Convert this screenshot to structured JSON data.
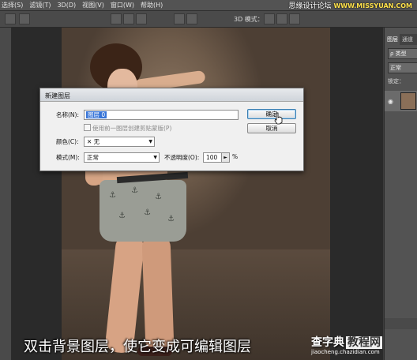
{
  "menu": {
    "items": [
      "选择(S)",
      "滤镜(T)",
      "3D(D)",
      "视图(V)",
      "窗口(W)",
      "帮助(H)"
    ]
  },
  "watermark_top": {
    "text": "思缘设计论坛",
    "url": "WWW.MISSYUAN.COM"
  },
  "options_bar": {
    "mode_label": "3D 模式："
  },
  "layers_panel": {
    "tabs": [
      "图层",
      "通道"
    ],
    "filter_label": "ρ 类型",
    "blend_mode": "正常",
    "lock_label": "锁定："
  },
  "dialog": {
    "title": "新建图层",
    "name_label": "名称(N):",
    "name_value": "图层 0",
    "clip_checkbox_label": "使用前一图层创建剪贴蒙版(P)",
    "color_label": "颜色(C):",
    "color_value": "✕ 无",
    "mode_label": "模式(M):",
    "mode_value": "正常",
    "opacity_label": "不透明度(O):",
    "opacity_value": "100",
    "opacity_unit": "%",
    "ok_label": "确定",
    "cancel_label": "取消"
  },
  "subtitle": "双击背景图层，使它变成可编辑图层",
  "watermark_bottom": {
    "brand": "查字典",
    "highlight": "教程网",
    "url": "jiaocheng.chazidian.com"
  }
}
